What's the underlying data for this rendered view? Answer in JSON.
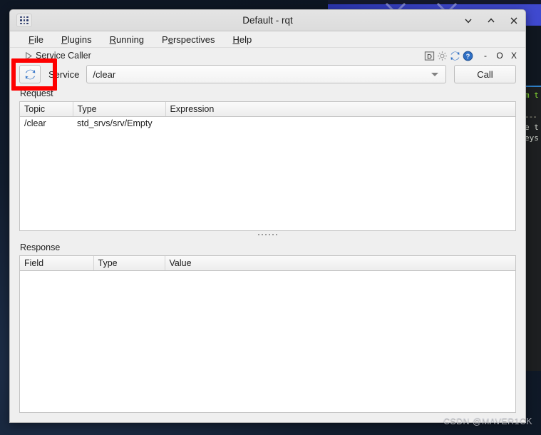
{
  "window": {
    "title": "Default - rqt",
    "app_icon": "app-grid-icon",
    "controls": {
      "minimize": "⌄",
      "maximize": "⌃",
      "close": "×"
    }
  },
  "menubar": {
    "items": [
      {
        "label": "File",
        "mnemonic": "F"
      },
      {
        "label": "Plugins",
        "mnemonic": "P"
      },
      {
        "label": "Running",
        "mnemonic": "R"
      },
      {
        "label": "Perspectives",
        "mnemonic": "e"
      },
      {
        "label": "Help",
        "mnemonic": "H"
      }
    ]
  },
  "dock": {
    "collapse_icon": "triangle-right-icon",
    "title": "Service Caller",
    "tools": [
      {
        "name": "dock-detach-icon",
        "label": "D"
      },
      {
        "name": "gear-icon",
        "label": ""
      },
      {
        "name": "refresh-icon",
        "label": ""
      },
      {
        "name": "help-icon",
        "label": ""
      }
    ],
    "controls": [
      {
        "name": "dock-minimize-button",
        "label": "-"
      },
      {
        "name": "dock-float-button",
        "label": "O"
      },
      {
        "name": "dock-close-button",
        "label": "X"
      }
    ]
  },
  "service_caller": {
    "refresh_button": {
      "name": "refresh-services-button",
      "icon": "refresh-icon"
    },
    "service_label": "Service",
    "service_combo": {
      "value": "/clear",
      "placeholder": "/clear",
      "options": [
        "/clear"
      ]
    },
    "call_button_label": "Call",
    "request": {
      "section_label": "Request",
      "columns": [
        "Topic",
        "Type",
        "Expression"
      ],
      "rows": [
        {
          "topic": "/clear",
          "type": "std_srvs/srv/Empty",
          "expression": ""
        }
      ]
    },
    "response": {
      "section_label": "Response",
      "columns": [
        "Field",
        "Type",
        "Value"
      ],
      "rows": []
    }
  },
  "background": {
    "terminal_lines": [
      {
        "text": "m t",
        "cls": "g"
      },
      {
        "text": "",
        "cls": "sep"
      },
      {
        "text": "e t",
        "cls": "w"
      },
      {
        "text": "eys",
        "cls": "w"
      }
    ]
  },
  "annotation": {
    "color": "#fe0000",
    "target": "refresh-services-button"
  },
  "watermark": "CSDN @MAVER1CK"
}
